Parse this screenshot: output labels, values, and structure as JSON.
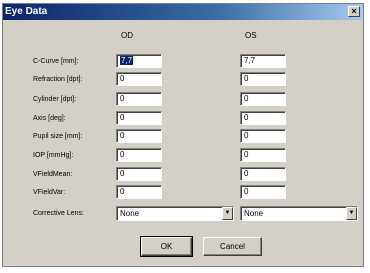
{
  "window": {
    "title": "Eye Data",
    "close_glyph": "×"
  },
  "columns": {
    "od": "OD",
    "os": "OS"
  },
  "rows": [
    {
      "label": "C-Curve [mm]:",
      "od": "7,7",
      "os": "7,7"
    },
    {
      "label": "Refraction [dpt]:",
      "od": "0",
      "os": "0"
    },
    {
      "label": "Cylinder [dpt]:",
      "od": "0",
      "os": "0"
    },
    {
      "label": "Axis [deg]:",
      "od": "0",
      "os": "0"
    },
    {
      "label": "Pupil size [mm]:",
      "od": "0",
      "os": "0"
    },
    {
      "label": "IOP [mmHg]:",
      "od": "0",
      "os": "0"
    },
    {
      "label": "VFieldMean:",
      "od": "0",
      "os": "0"
    },
    {
      "label": "VFieldVar:",
      "od": "0",
      "os": "0"
    }
  ],
  "corrective_lens": {
    "label": "Corrective Lens:",
    "od": "None",
    "os": "None"
  },
  "buttons": {
    "ok": "OK",
    "cancel": "Cancel"
  },
  "icons": {
    "dropdown": "chevron-down-icon",
    "close": "close-icon"
  }
}
